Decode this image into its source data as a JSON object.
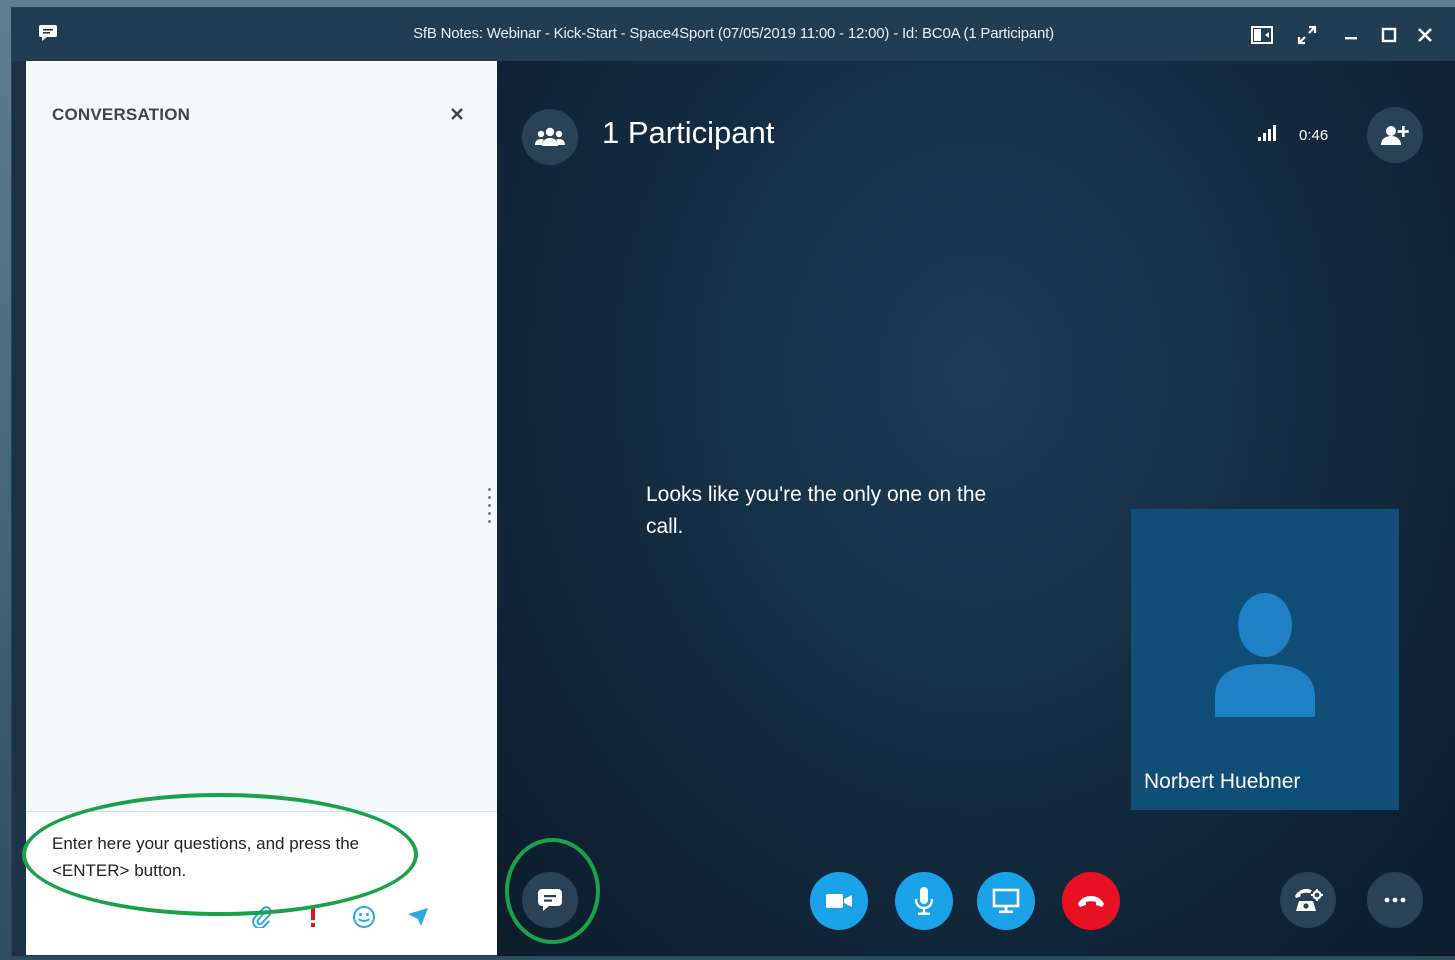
{
  "window": {
    "title": "SfB Notes: Webinar - Kick-Start - Space4Sport (07/05/2019 11:00 -  12:00) - Id: BC0A (1 Participant)",
    "icons": [
      "chat-bubble-icon",
      "layout-icon",
      "fullscreen-icon",
      "minimize-icon",
      "maximize-icon",
      "close-icon"
    ]
  },
  "conversation": {
    "title": "CONVERSATION",
    "compose_text": "Enter here your questions, and press the <ENTER> button.",
    "tools": [
      "paperclip-icon",
      "importance-icon",
      "emoji-icon",
      "send-icon"
    ]
  },
  "stage": {
    "participants_label": "1 Participant",
    "call_duration": "0:46",
    "empty_message": "Looks like you're the only one on the call.",
    "participant_name": "Norbert Huebner"
  },
  "controls": {
    "buttons": [
      "chat-icon",
      "video-icon",
      "microphone-icon",
      "present-icon",
      "hang-up-icon",
      "call-controls-icon",
      "more-options-icon"
    ]
  },
  "colors": {
    "stage_bg": "#132a3e",
    "accent_blue": "#1aa3e8",
    "hangup_red": "#e81123",
    "annotation_green": "#1aa14a",
    "tile_bg": "#114e77"
  }
}
